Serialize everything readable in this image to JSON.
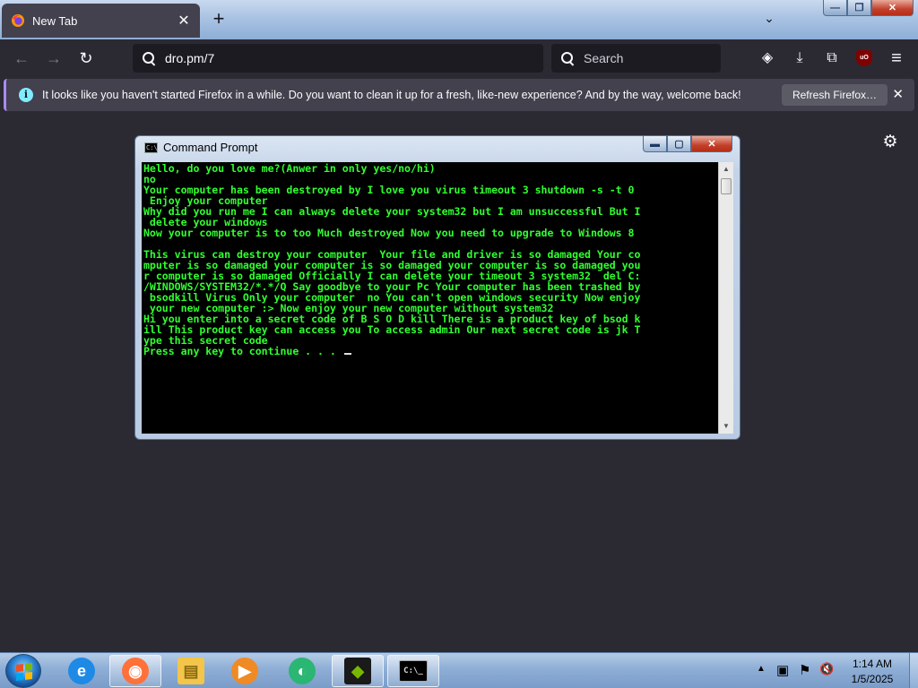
{
  "window_controls": {
    "minimize": "—",
    "maximize": "❐",
    "close": "✕"
  },
  "browser": {
    "tab": {
      "title": "New Tab",
      "close": "✕"
    },
    "new_tab": "+",
    "tab_list": "⌄",
    "nav": {
      "back": "←",
      "forward": "→",
      "reload": "↻"
    },
    "url": "dro.pm/7",
    "search_placeholder": "Search",
    "toolbar": {
      "pocket": "◈",
      "downloads": "⤓",
      "extensions": "⧉",
      "ublock": "uO",
      "menu": "≡"
    },
    "notification": {
      "info_glyph": "i",
      "message": "It looks like you haven't started Firefox in a while. Do you want to clean it up for a fresh, like-new experience? And by the way, welcome back!",
      "button": "Refresh Firefox…",
      "close": "✕"
    },
    "settings_glyph": "⚙"
  },
  "cmd_window": {
    "title": "Command Prompt",
    "icon_text": "C:\\_",
    "controls": {
      "minimize": "▬",
      "maximize": "▢",
      "close": "✕"
    },
    "lines": [
      "Hello, do you love me?(Anwer in only yes/no/hi)",
      "no",
      "Your computer has been destroyed by I love you virus timeout 3 shutdown -s -t 0",
      " Enjoy your computer",
      "Why did you run me I can always delete your system32 but I am unsuccessful But I",
      " delete your windows",
      "Now your computer is to too Much destroyed Now you need to upgrade to Windows 8",
      "",
      "This virus can destroy your computer  Your file and driver is so damaged Your co",
      "mputer is so damaged your computer is so damaged your computer is so damaged you",
      "r computer is so damaged Officially I can delete your timeout 3 system32  del C:",
      "/WINDOWS/SYSTEM32/*.*/Q Say goodbye to your Pc Your computer has been trashed by",
      " bsodkill Virus Only your computer  no You can't open windows security Now enjoy",
      " your new computer :> Now enjoy your new computer without system32",
      "Hi you enter into a secret code of B S O D kill There is a product key of bsod k",
      "ill This product key can access you To access admin Our next secret code is jk T",
      "ype this secret code",
      "Press any key to continue . . . "
    ],
    "scroll_up": "▲",
    "scroll_down": "▼"
  },
  "taskbar": {
    "apps": [
      {
        "name": "internet-explorer",
        "glyph": "e",
        "color": "#1e8ae6"
      },
      {
        "name": "firefox",
        "glyph": "◉",
        "color": "#ff7139"
      },
      {
        "name": "file-explorer",
        "glyph": "▤",
        "color": "#f3c54b"
      },
      {
        "name": "media-player",
        "glyph": "▶",
        "color": "#f08a24"
      },
      {
        "name": "media-center",
        "glyph": "◐",
        "color": "#2bb673"
      },
      {
        "name": "nvidia-geforce",
        "glyph": "◆",
        "color": "#76b900"
      },
      {
        "name": "command-prompt",
        "glyph": "C:\\_",
        "color": "#000000"
      }
    ],
    "tray": {
      "show_hidden": "▲",
      "network": "▣",
      "action_center": "⚑",
      "volume": "🔇"
    },
    "clock": {
      "time": "1:14 AM",
      "date": "1/5/2025"
    }
  }
}
